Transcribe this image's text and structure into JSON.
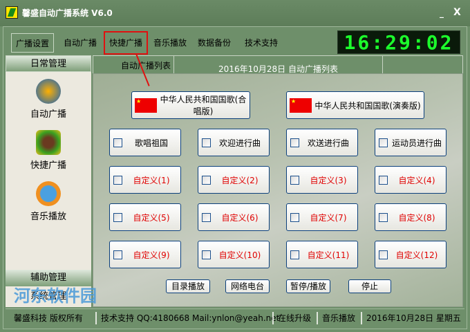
{
  "window": {
    "title": "馨盛自动广播系统 V6.0",
    "minimize": "_",
    "close": "X"
  },
  "menu": [
    "广播设置",
    "自动广播",
    "快捷广播",
    "音乐播放",
    "数据备份",
    "技术支持"
  ],
  "clock": "16:29:02",
  "sidebar": {
    "header": "日常管理",
    "items": [
      {
        "label": "自动广播",
        "icon": "globe-icon"
      },
      {
        "label": "快捷广播",
        "icon": "palm-tree-icon"
      },
      {
        "label": "音乐播放",
        "icon": "play-icon"
      }
    ],
    "aux": "辅助管理",
    "system": "系统管理"
  },
  "tabs": {
    "list": "自动广播列表",
    "title": "2016年10月28日 自动广播列表"
  },
  "anthems": [
    "中华人民共和国国歌(合唱版)",
    "中华人民共和国国歌(演奏版)"
  ],
  "songs": [
    "歌唱祖国",
    "欢迎进行曲",
    "欢送进行曲",
    "运动员进行曲"
  ],
  "custom": [
    "自定义(1)",
    "自定义(2)",
    "自定义(3)",
    "自定义(4)",
    "自定义(5)",
    "自定义(6)",
    "自定义(7)",
    "自定义(8)",
    "自定义(9)",
    "自定义(10)",
    "自定义(11)",
    "自定义(12)"
  ],
  "controls": [
    "目录播放",
    "网络电台",
    "暂停/播放",
    "停止"
  ],
  "status": {
    "copyright": "馨盛科技 版权所有",
    "support": "技术支持 QQ:4180668  Mail:ynlon@yeah.net",
    "upgrade": "在线升级",
    "music": "音乐播放",
    "date": "2016年10月28日 星期五"
  },
  "watermark": "河东软件园",
  "colors": {
    "accent": "#e01010",
    "clock": "#1cff2c",
    "custom_text": "#e00000"
  }
}
